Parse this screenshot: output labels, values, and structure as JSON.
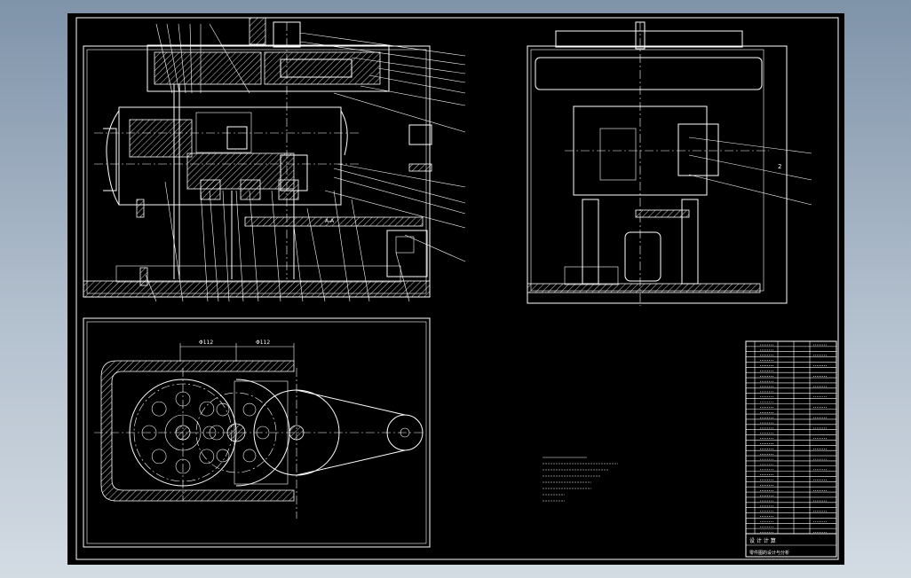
{
  "drawing": {
    "background": "#000000",
    "line_color": "#ffffff",
    "front_view": {
      "section_label": "A-A"
    },
    "plan_view": {
      "section_marks": [
        "Φ112",
        "Φ112"
      ]
    },
    "side_view": {
      "label": "2"
    },
    "title_block": {
      "title_rows": [
        "设 计 计 算",
        "零件图的设计与分析"
      ]
    }
  }
}
